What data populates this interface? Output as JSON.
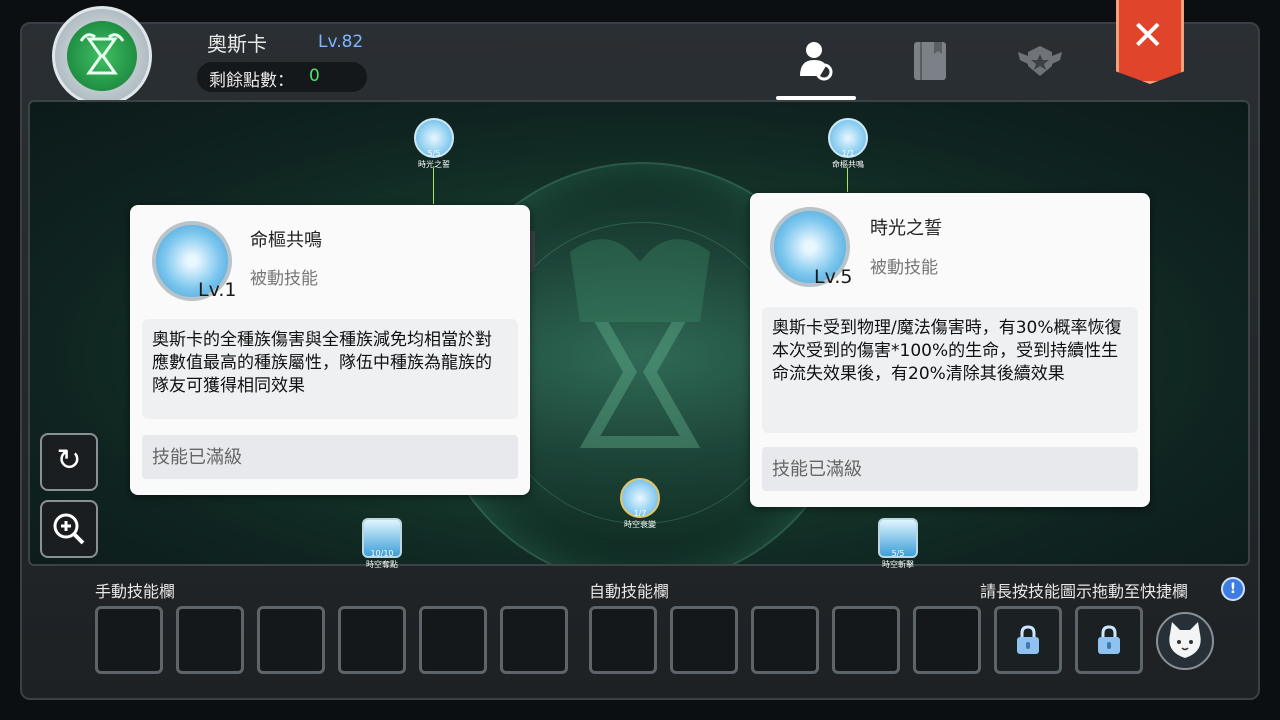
{
  "header": {
    "character_name": "奧斯卡",
    "level": "Lv.82",
    "points_label": "剩餘點數：",
    "points_value": "0",
    "emblem_icon": "dragon-hourglass-emblem-icon",
    "tabs": [
      {
        "icon": "character-skill-icon",
        "active": true
      },
      {
        "icon": "book-icon",
        "active": false
      },
      {
        "icon": "rank-badge-icon",
        "active": false
      }
    ],
    "close_icon": "close-icon"
  },
  "tree_nodes": [
    {
      "level": "5/5",
      "name": "時光之誓"
    },
    {
      "level": "1/1",
      "name": "命樞共鳴"
    },
    {
      "level": "1/7",
      "name": "時空衰變"
    },
    {
      "level": "10/10",
      "name": "時空奪點"
    },
    {
      "level": "5/5",
      "name": "時空斬擊"
    }
  ],
  "left_panel": {
    "title": "命樞共鳴",
    "type": "被動技能",
    "level": "Lv.1",
    "description": "奧斯卡的全種族傷害與全種族減免均相當於對應數值最高的種族屬性，隊伍中種族為龍族的隊友可獲得相同效果",
    "status": "技能已滿級"
  },
  "right_panel": {
    "title": "時光之誓",
    "type": "被動技能",
    "level": "Lv.5",
    "description": "奧斯卡受到物理/魔法傷害時，有30%概率恢復本次受到的傷害*100%的生命，受到持續性生命流失效果後，有20%清除其後續效果",
    "status": "技能已滿級"
  },
  "side_controls": {
    "reset_icon": "reset-icon",
    "zoom_icon": "zoom-in-icon"
  },
  "bottom": {
    "manual_label": "手動技能欄",
    "auto_label": "自動技能欄",
    "hint": "請長按技能圖示拖動至快捷欄",
    "manual_slots": 6,
    "auto_slots": 5,
    "locked_slots": 2
  },
  "colors": {
    "accent_green": "#4fe36b",
    "level_blue": "#7fb4ff",
    "close_red": "#e0452c"
  }
}
